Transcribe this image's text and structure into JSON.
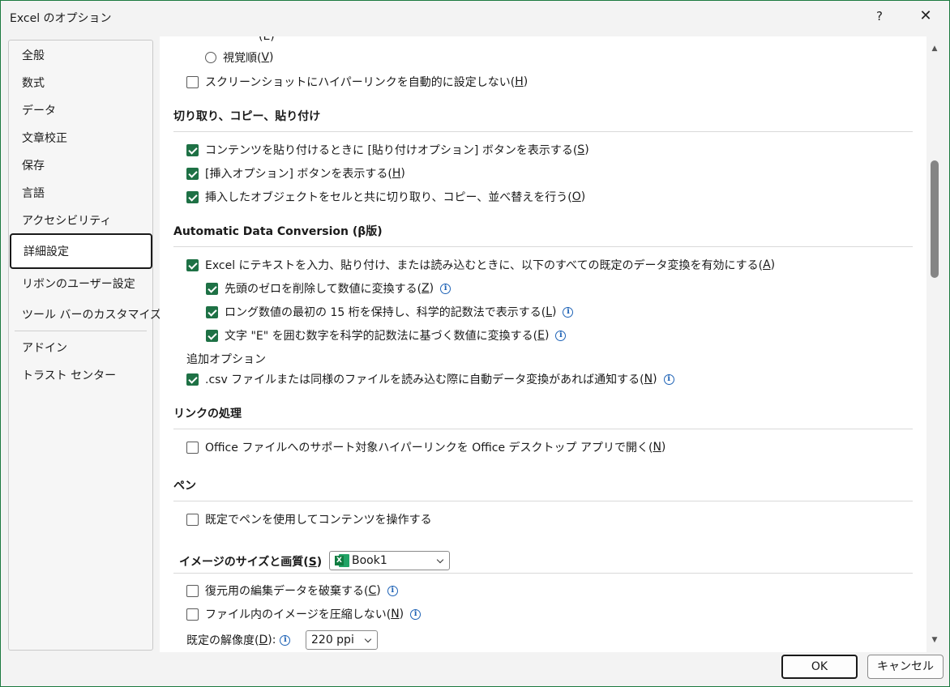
{
  "window": {
    "title": "Excel のオプション",
    "help_label": "?",
    "close_label": "✕"
  },
  "sidebar": {
    "items": [
      {
        "label": "全般"
      },
      {
        "label": "数式"
      },
      {
        "label": "データ"
      },
      {
        "label": "文章校正"
      },
      {
        "label": "保存"
      },
      {
        "label": "言語"
      },
      {
        "label": "アクセシビリティ"
      },
      {
        "label": "詳細設定",
        "selected": true
      },
      {
        "label": "リボンのユーザー設定"
      },
      {
        "label": "ツール バーのカスタマイズ"
      },
      {
        "label": "アドイン"
      },
      {
        "label": "トラスト センター"
      }
    ]
  },
  "content": {
    "top_partial_label": "(E)",
    "visual_order": {
      "text": "視覚順(",
      "key": "V",
      "close": ")"
    },
    "screenshot_link": {
      "text": "スクリーンショットにハイパーリンクを自動的に設定しない(",
      "key": "H",
      "close": ")",
      "checked": false
    },
    "cut_copy_paste": {
      "title": "切り取り、コピー、貼り付け",
      "opt1": {
        "text": "コンテンツを貼り付けるときに [貼り付けオプション] ボタンを表示する(",
        "key": "S",
        "close": ")",
        "checked": true
      },
      "opt2": {
        "text": "[挿入オプション] ボタンを表示する(",
        "key": "H",
        "close": ")",
        "checked": true
      },
      "opt3": {
        "text": "挿入したオブジェクトをセルと共に切り取り、コピー、並べ替えを行う(",
        "key": "O",
        "close": ")",
        "checked": true
      }
    },
    "auto_conversion": {
      "title": "Automatic Data Conversion (β版)",
      "main": {
        "text": "Excel にテキストを入力、貼り付け、または読み込むときに、以下のすべての既定のデータ変換を有効にする(",
        "key": "A",
        "close": ")",
        "checked": true
      },
      "sub1": {
        "text": "先頭のゼロを削除して数値に変換する(",
        "key": "Z",
        "close": ")",
        "checked": true
      },
      "sub2": {
        "text": "ロング数値の最初の 15 桁を保持し、科学的記数法で表示する(",
        "key": "L",
        "close": ")",
        "checked": true
      },
      "sub3": {
        "text": "文字 \"E\" を囲む数字を科学的記数法に基づく数値に変換する(",
        "key": "E",
        "close": ")",
        "checked": true
      },
      "additional_label": "追加オプション",
      "csv": {
        "text": ".csv ファイルまたは同様のファイルを読み込む際に自動データ変換があれば通知する(",
        "key": "N",
        "close": ")",
        "checked": true
      }
    },
    "links": {
      "title": "リンクの処理",
      "opt1": {
        "text": "Office ファイルへのサポート対象ハイパーリンクを Office デスクトップ アプリで開く(",
        "key": "N",
        "close": ")",
        "checked": false
      }
    },
    "pen": {
      "title": "ペン",
      "opt1": {
        "text": "既定でペンを使用してコンテンツを操作する",
        "checked": false
      }
    },
    "image": {
      "title_text": "イメージのサイズと画質(",
      "title_key": "S",
      "title_close": ")",
      "workbook": "Book1",
      "excel_icon_letter": "X",
      "opt1": {
        "text": "復元用の編集データを破棄する(",
        "key": "C",
        "close": ")",
        "checked": false
      },
      "opt2": {
        "text": "ファイル内のイメージを圧縮しない(",
        "key": "N",
        "close": ")",
        "checked": false
      },
      "resolution_text": "既定の解像度(",
      "resolution_key": "D",
      "resolution_close": "):",
      "resolution_value": "220 ppi"
    }
  },
  "info_glyph": "i",
  "footer": {
    "ok_label": "OK",
    "cancel_label": "キャンセル"
  },
  "colors": {
    "checkbox_checked": "#1e7145",
    "info_icon": "#1f63b6",
    "window_border": "#1c7a3f"
  }
}
